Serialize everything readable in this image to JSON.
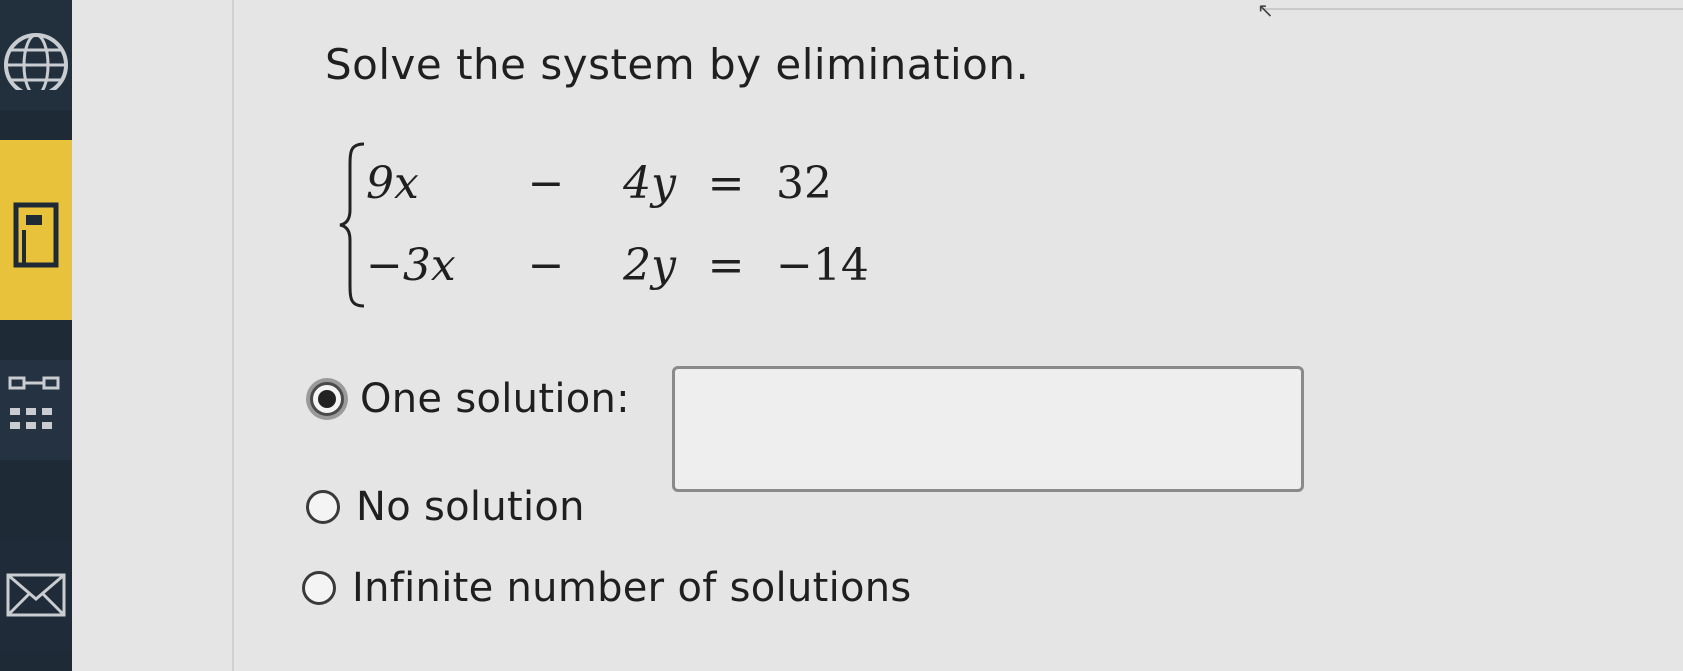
{
  "sidebar": {
    "items": [
      {
        "icon": "globe-icon"
      },
      {
        "icon": "calculator-icon"
      },
      {
        "icon": "tools-icon"
      },
      {
        "icon": "mail-icon"
      }
    ],
    "accent": "#e8c23a"
  },
  "question": {
    "prompt": "Solve the system by elimination.",
    "equations": [
      {
        "a": "9x",
        "op": "−",
        "b": "4y",
        "eq": "=",
        "rhs": "32"
      },
      {
        "a": "−3x",
        "op": "−",
        "b": "2y",
        "eq": "=",
        "rhs": "−14"
      }
    ]
  },
  "options": {
    "one_solution_label": "One solution:",
    "one_solution_value": "",
    "no_solution_label": "No solution",
    "infinite_label": "Infinite number of solutions",
    "selected": "one_solution"
  }
}
